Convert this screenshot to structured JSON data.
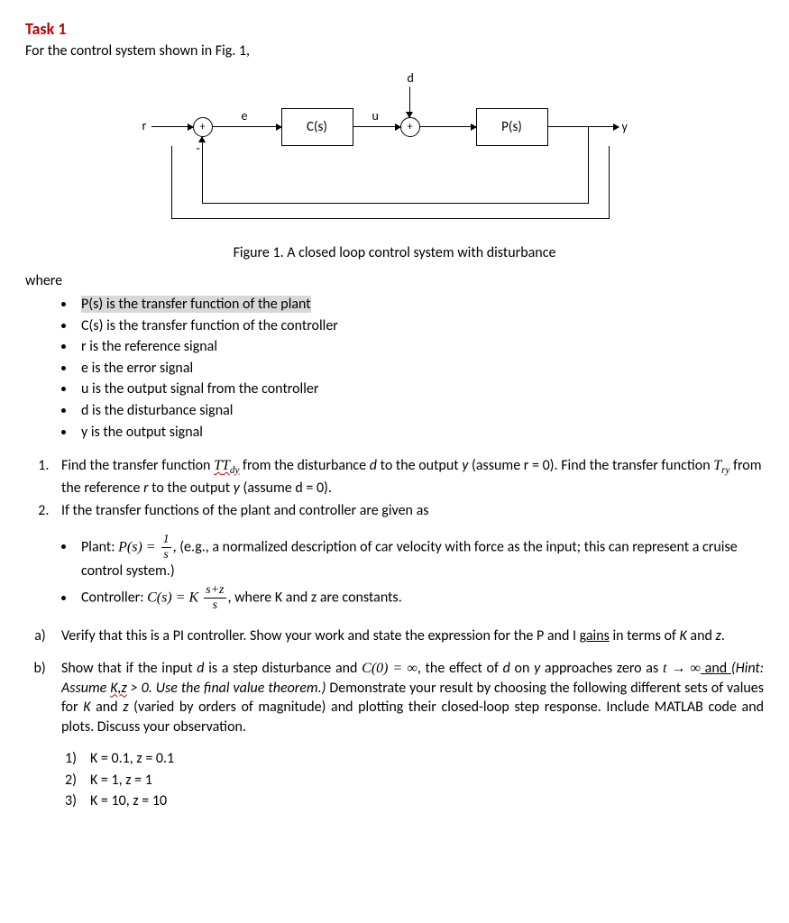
{
  "task_title": "Task 1",
  "intro": "For the control system shown in Fig. 1,",
  "diagram": {
    "r": "r",
    "e": "e",
    "Cs": "C(s)",
    "u": "u",
    "d": "d",
    "Ps": "P(s)",
    "y": "y",
    "sum_plus": "+",
    "sum_minus": "-"
  },
  "fig_caption": "Figure 1. A closed loop control system with disturbance",
  "where_label": "where",
  "definitions": [
    "P(s) is the transfer function of the plant",
    "C(s) is the transfer function of the controller",
    "r is the reference signal",
    "e is the error signal",
    "u is the output signal from the controller",
    "d is the disturbance signal",
    "y is the output signal"
  ],
  "tasks": {
    "item1_pre": "Find the transfer function ",
    "item1_Tdy": "Tdy",
    "item1_mid1": " from the disturbance ",
    "item1_d": "d",
    "item1_mid2": " to the output ",
    "item1_y": "y",
    "item1_mid3": " (assume r = 0). Find the transfer function ",
    "item1_Try": "Try",
    "item1_mid4": " from the reference ",
    "item1_r": "r",
    "item1_mid5": " to the output ",
    "item1_y2": "y",
    "item1_end": " (assume d = 0).",
    "item2": "If the transfer functions of the plant and controller are given as"
  },
  "sub": {
    "plant_pre": "Plant: ",
    "plant_lhs": "P(s) = ",
    "plant_num": "1",
    "plant_den": "s",
    "plant_post": ", (e.g., a normalized description of car velocity with force as the input; this can represent a cruise control system.)",
    "ctrl_pre": "Controller: ",
    "ctrl_lhs": "C(s) = K ",
    "ctrl_num": "s+z",
    "ctrl_den": "s",
    "ctrl_post": ", where K and z are constants."
  },
  "parts": {
    "a_pre": "Verify that this is a PI controller. Show your work and state the expression for the P and I ",
    "a_gains": "gains",
    "a_post": " in terms of ",
    "a_K": "K",
    "a_and": " and ",
    "a_z": "z",
    "a_end": ".",
    "b_pre": "Show that if the input ",
    "b_d": "d",
    "b_t1": " is a step disturbance and ",
    "b_C0": "C(0) = ∞",
    "b_t2": ", the effect of ",
    "b_d2": "d",
    "b_t3": " on ",
    "b_y": "y",
    "b_t4": " approaches zero as ",
    "b_lim": "t → ∞",
    "b_and": " and  ",
    "b_hint": "(Hint: Assume ",
    "b_Kz": "K,z",
    "b_hint2": " > 0. Use the final value theorem.)",
    "b_t5": " Demonstrate your result by choosing the following different sets of values for ",
    "b_K": "K",
    "b_t6": " and ",
    "b_z": "z",
    "b_t7": " (varied by orders of magnitude) and plotting their closed-loop step response. Include MATLAB code and plots. Discuss your observation."
  },
  "cases": [
    "K = 0.1, z = 0.1",
    "K = 1, z = 1",
    "K = 10, z = 10"
  ]
}
